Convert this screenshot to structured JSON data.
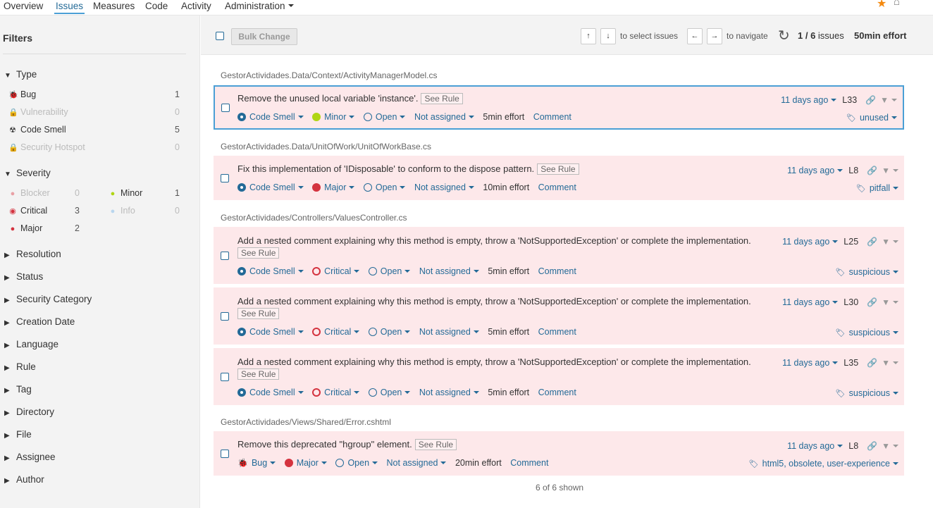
{
  "nav": {
    "tabs": [
      "Overview",
      "Issues",
      "Measures",
      "Code",
      "Activity",
      "Administration"
    ],
    "active": "Issues"
  },
  "sidebar": {
    "title": "Filters",
    "type": {
      "label": "Type",
      "items": [
        {
          "label": "Bug",
          "count": "1",
          "icon": "bug-icon",
          "disabled": false
        },
        {
          "label": "Vulnerability",
          "count": "0",
          "icon": "lock-icon",
          "disabled": true
        },
        {
          "label": "Code Smell",
          "count": "5",
          "icon": "code-smell-icon",
          "disabled": false
        },
        {
          "label": "Security Hotspot",
          "count": "0",
          "icon": "lock-icon",
          "disabled": true
        }
      ]
    },
    "severity": {
      "label": "Severity",
      "items": [
        {
          "label": "Blocker",
          "count": "0",
          "disabled": true
        },
        {
          "label": "Minor",
          "count": "1",
          "disabled": false
        },
        {
          "label": "Critical",
          "count": "3",
          "disabled": false
        },
        {
          "label": "Info",
          "count": "0",
          "disabled": true
        },
        {
          "label": "Major",
          "count": "2",
          "disabled": false
        }
      ]
    },
    "facets": [
      "Resolution",
      "Status",
      "Security Category",
      "Creation Date",
      "Language",
      "Rule",
      "Tag",
      "Directory",
      "File",
      "Assignee",
      "Author"
    ]
  },
  "toolbar": {
    "bulk_change": "Bulk Change",
    "up_key": "↑",
    "down_key": "↓",
    "select_text": "to select issues",
    "left_key": "←",
    "right_key": "→",
    "navigate_text": "to navigate",
    "issues_count": "1 / 6",
    "issues_word": "issues",
    "effort": "50min effort"
  },
  "files": [
    "GestorActividades.Data/Context/ActivityManagerModel.cs",
    "GestorActividades.Data/UnitOfWork/UnitOfWorkBase.cs",
    "GestorActividades/Controllers/ValuesController.cs",
    "GestorActividades/Views/Shared/Error.cshtml"
  ],
  "see_rule": "See Rule",
  "issues": [
    {
      "message": "Remove the unused local variable 'instance'.",
      "type": "Code Smell",
      "severity": "Minor",
      "status": "Open",
      "assignee": "Not assigned",
      "effort": "5min effort",
      "comment": "Comment",
      "age": "11 days ago",
      "line": "L33",
      "tags": "unused"
    },
    {
      "message": "Fix this implementation of 'IDisposable' to conform to the dispose pattern.",
      "type": "Code Smell",
      "severity": "Major",
      "status": "Open",
      "assignee": "Not assigned",
      "effort": "10min effort",
      "comment": "Comment",
      "age": "11 days ago",
      "line": "L8",
      "tags": "pitfall"
    },
    {
      "message": "Add a nested comment explaining why this method is empty, throw a 'NotSupportedException' or complete the implementation.",
      "type": "Code Smell",
      "severity": "Critical",
      "status": "Open",
      "assignee": "Not assigned",
      "effort": "5min effort",
      "comment": "Comment",
      "age": "11 days ago",
      "line": "L25",
      "tags": "suspicious"
    },
    {
      "message": "Add a nested comment explaining why this method is empty, throw a 'NotSupportedException' or complete the implementation.",
      "type": "Code Smell",
      "severity": "Critical",
      "status": "Open",
      "assignee": "Not assigned",
      "effort": "5min effort",
      "comment": "Comment",
      "age": "11 days ago",
      "line": "L30",
      "tags": "suspicious"
    },
    {
      "message": "Add a nested comment explaining why this method is empty, throw a 'NotSupportedException' or complete the implementation.",
      "type": "Code Smell",
      "severity": "Critical",
      "status": "Open",
      "assignee": "Not assigned",
      "effort": "5min effort",
      "comment": "Comment",
      "age": "11 days ago",
      "line": "L35",
      "tags": "suspicious"
    },
    {
      "message": "Remove this deprecated \"hgroup\" element.",
      "type": "Bug",
      "severity": "Major",
      "status": "Open",
      "assignee": "Not assigned",
      "effort": "20min effort",
      "comment": "Comment",
      "age": "11 days ago",
      "line": "L8",
      "tags": "html5, obsolete, user-experience"
    }
  ],
  "footer": {
    "shown": "6 of 6 shown"
  },
  "colors": {
    "accent": "#236a97",
    "issue_bg": "#fde8ea",
    "critical": "#d4333f",
    "minor": "#b0d513",
    "star": "#f4890f"
  }
}
